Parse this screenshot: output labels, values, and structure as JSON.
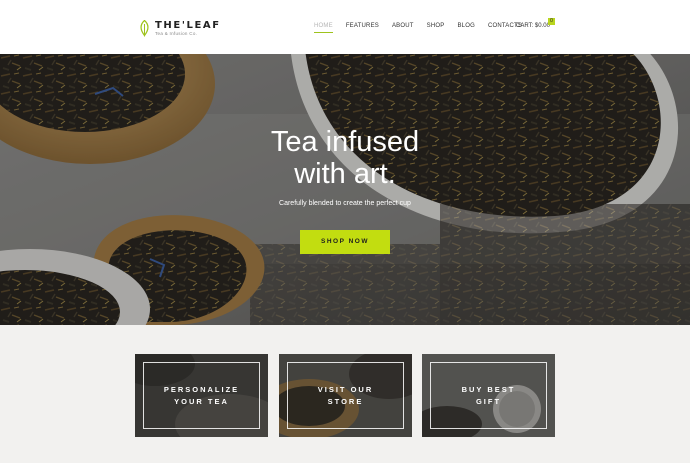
{
  "logo": {
    "title": "THE'LEAF",
    "subtitle": "Tea & Infusion Co."
  },
  "nav": {
    "items": [
      "HOME",
      "FEATURES",
      "ABOUT",
      "SHOP",
      "BLOG",
      "CONTACTS"
    ],
    "active_index": 0
  },
  "cart": {
    "label": "CART: $0.00",
    "count": "0"
  },
  "hero": {
    "title_line1": "Tea infused",
    "title_line2": "with art.",
    "subtitle": "Carefully blended to create the perfect cup",
    "button_label": "SHOP NOW"
  },
  "cards": [
    {
      "label": "PERSONALIZE\nYOUR TEA"
    },
    {
      "label": "VISIT OUR\nSTORE"
    },
    {
      "label": "BUY BEST\nGIFT"
    }
  ],
  "colors": {
    "accent": "#c2dd10",
    "header_bg": "#ffffff",
    "page_bg": "#f2f1ef"
  },
  "icons": {
    "logo": "leaf-icon"
  }
}
